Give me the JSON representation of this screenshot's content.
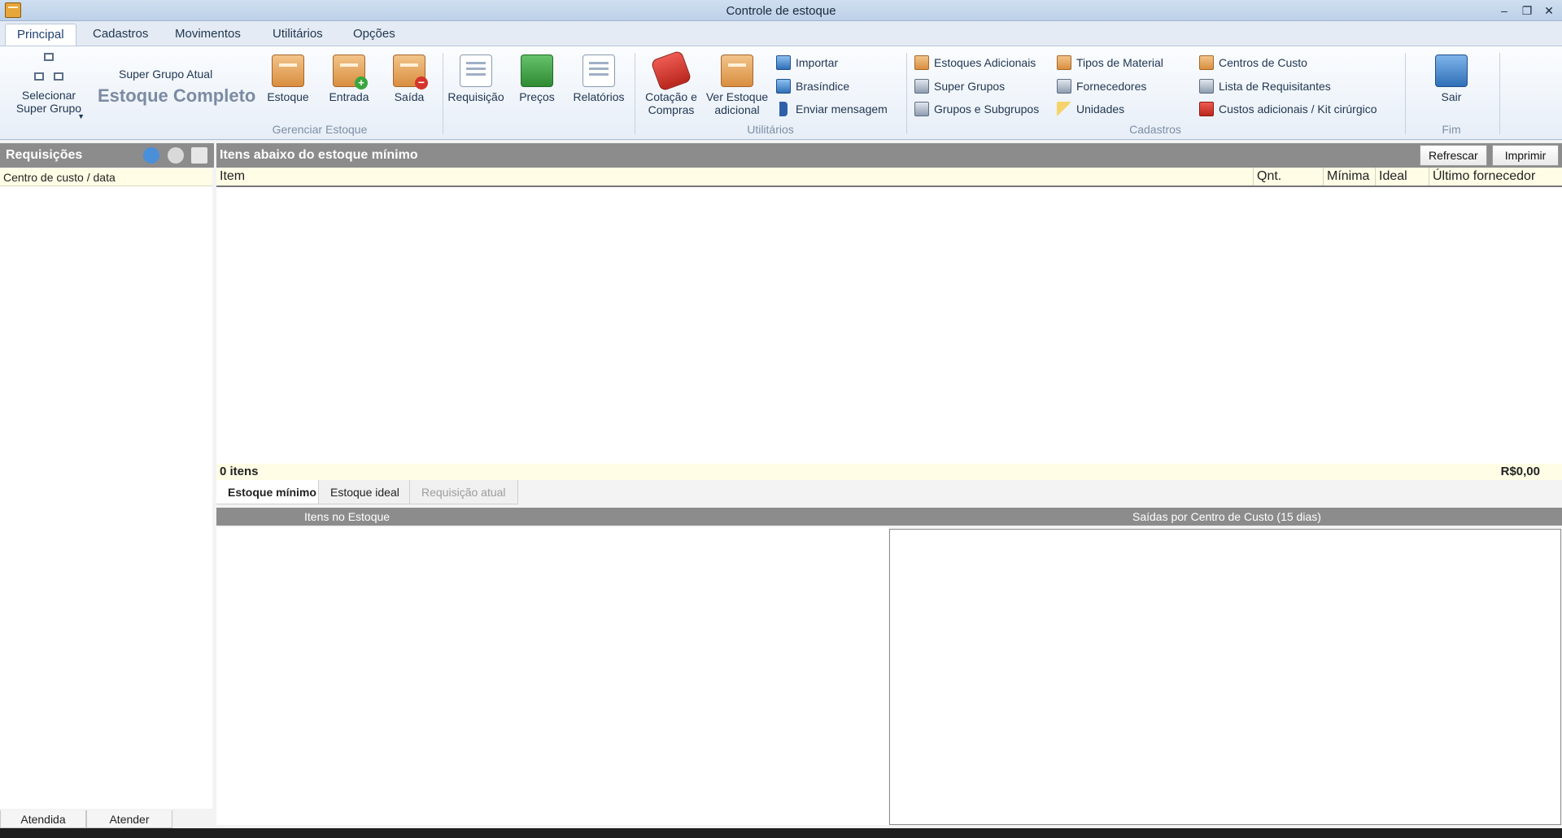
{
  "window": {
    "title": "Controle de estoque"
  },
  "menu": {
    "tabs": [
      "Principal",
      "Cadastros",
      "Movimentos",
      "Utilitários",
      "Opções"
    ]
  },
  "ribbon": {
    "select_super_group": "Selecionar\nSuper Grupo",
    "super_group_label": "Super Grupo Atual",
    "super_group_value": "Estoque Completo",
    "manage": {
      "estoque": "Estoque",
      "entrada": "Entrada",
      "saida": "Saída",
      "group_label": "Gerenciar Estoque"
    },
    "utilities": {
      "requisicao": "Requisição",
      "precos": "Preços",
      "relatorios": "Relatórios",
      "cotacao": "Cotação e\nCompras",
      "ver_estoque": "Ver Estoque\nadicional",
      "importar": "Importar",
      "brasindice": "Brasíndice",
      "enviar": "Enviar mensagem",
      "group_label": "Utilitários"
    },
    "cadastros": {
      "estoques_adicionais": "Estoques Adicionais",
      "super_grupos": "Super Grupos",
      "grupos_subgrupos": "Grupos e Subgrupos",
      "tipos_material": "Tipos de Material",
      "fornecedores": "Fornecedores",
      "unidades": "Unidades",
      "centros_custo": "Centros de Custo",
      "lista_requisitantes": "Lista de Requisitantes",
      "custos_adicionais": "Custos adicionais / Kit cirúrgico",
      "group_label": "Cadastros"
    },
    "fim": {
      "sair": "Sair",
      "group_label": "Fim"
    }
  },
  "left_panel": {
    "title": "Requisições",
    "column_header": "Centro de custo / data",
    "tabs": [
      "Atendida",
      "Atender"
    ]
  },
  "main_panel": {
    "title": "Itens abaixo do estoque mínimo",
    "refresh_label": "Refrescar",
    "print_label": "Imprimir",
    "columns": [
      "Item",
      "Qnt.",
      "Mínima",
      "Ideal",
      "Último fornecedor"
    ],
    "count_text": "0 itens",
    "total_text": "R$0,00",
    "sub_tabs": [
      "Estoque mínimo",
      "Estoque ideal",
      "Requisição atual"
    ]
  },
  "bottom": {
    "left_title": "Itens no Estoque",
    "right_title": "Saídas por Centro de Custo (15 dias)"
  }
}
